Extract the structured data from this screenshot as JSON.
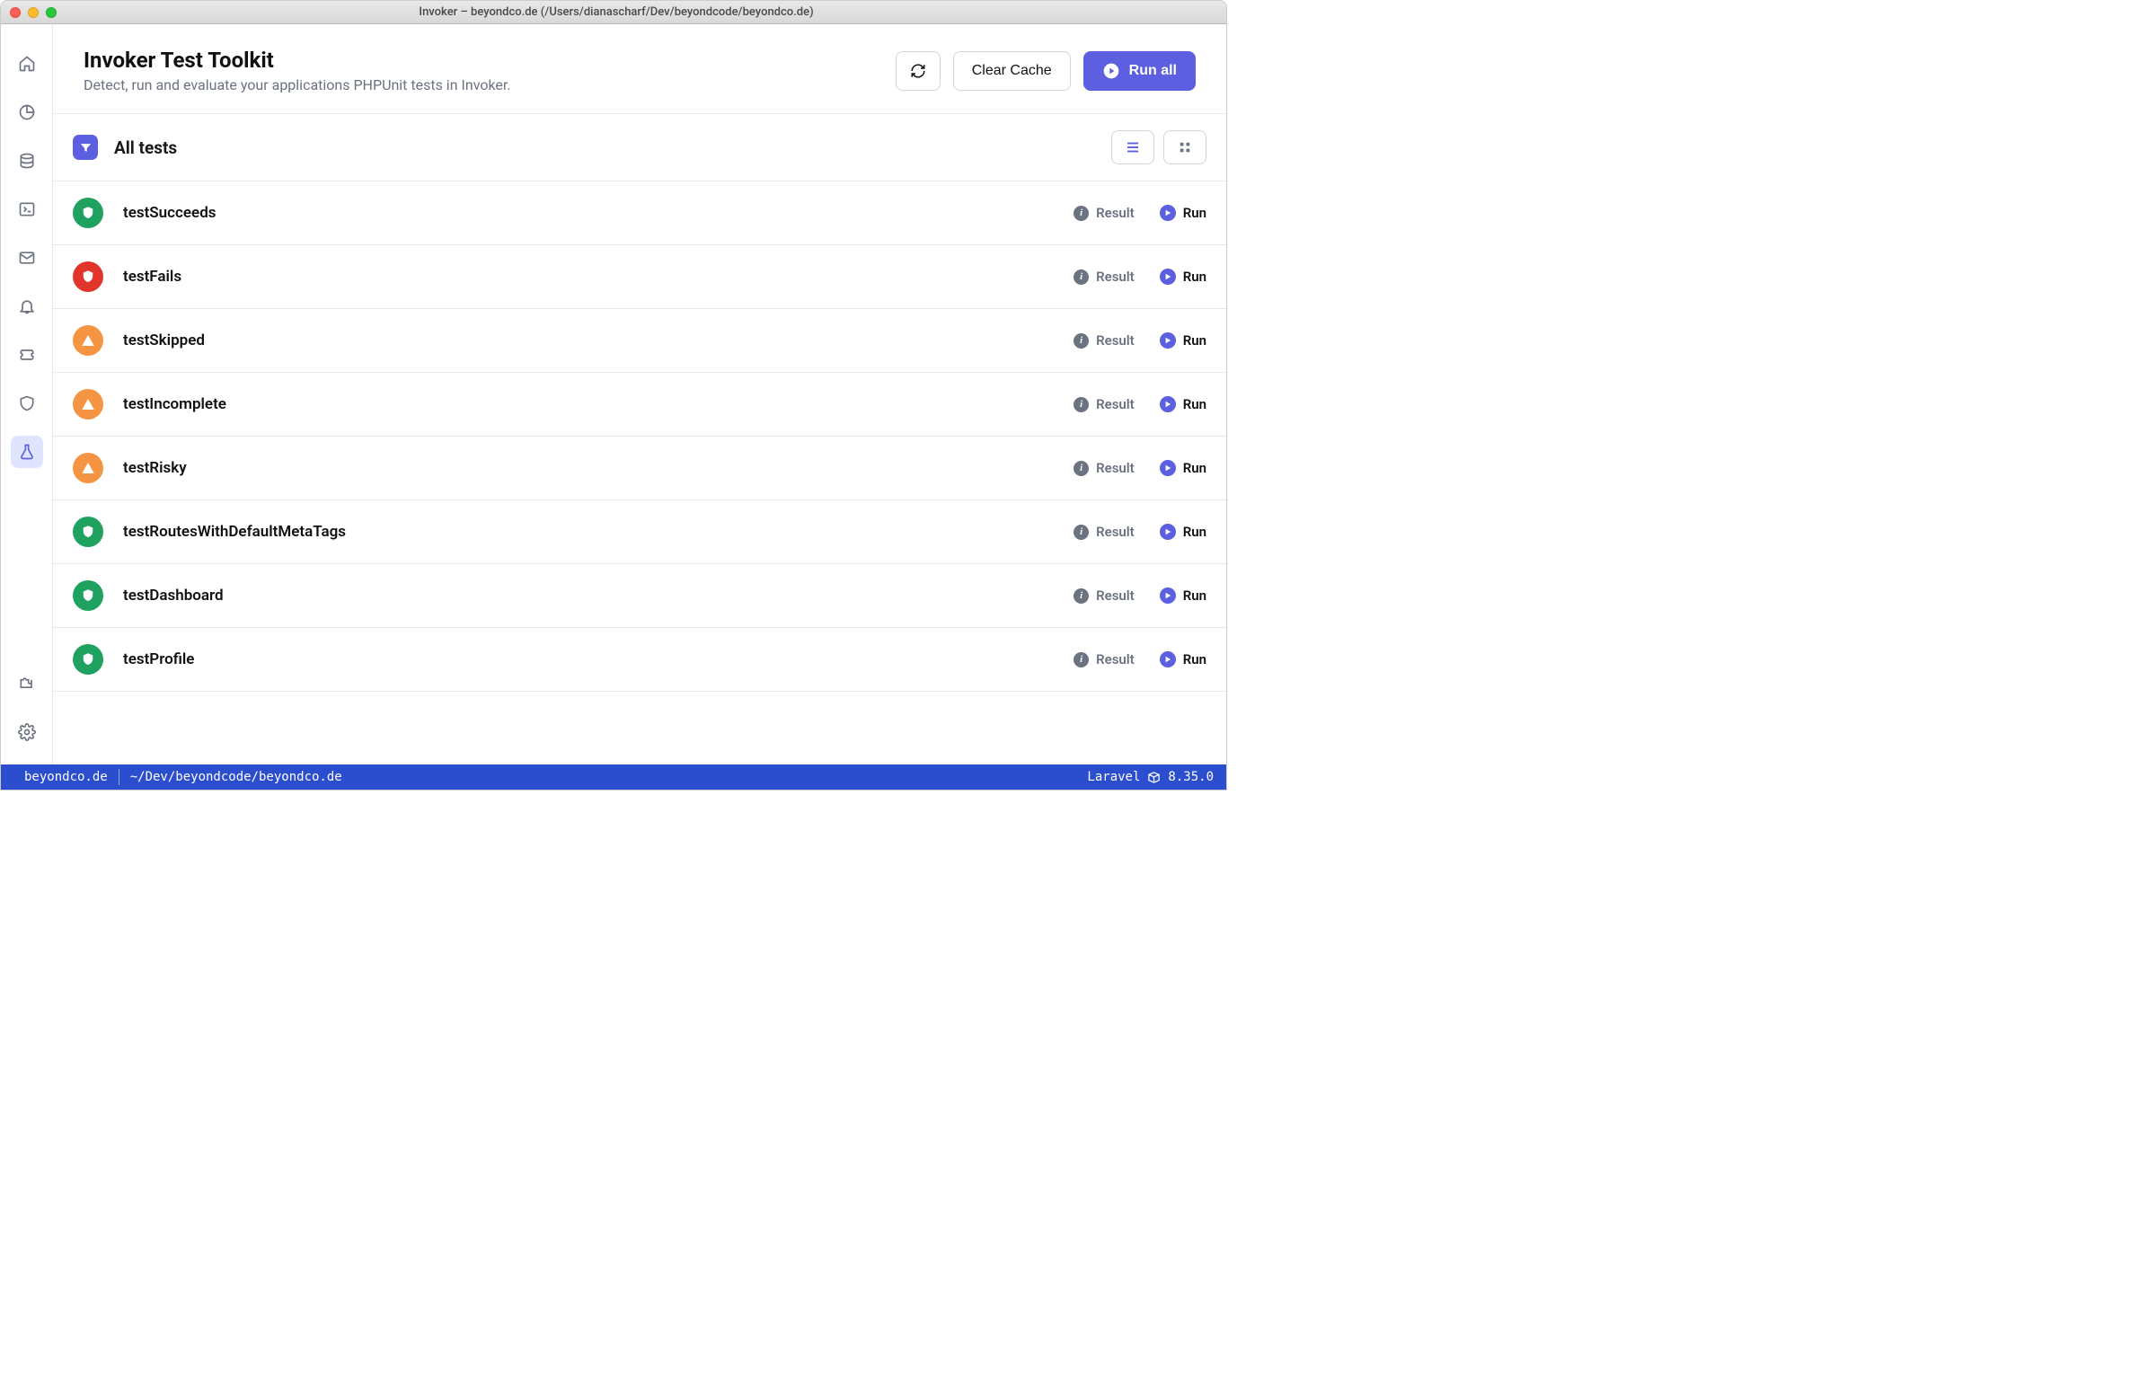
{
  "window": {
    "title": "Invoker – beyondco.de (/Users/dianascharf/Dev/beyondcode/beyondco.de)"
  },
  "header": {
    "title": "Invoker Test Toolkit",
    "subtitle": "Detect, run and evaluate your applications PHPUnit tests in Invoker.",
    "clear_cache_label": "Clear Cache",
    "run_all_label": "Run all"
  },
  "section": {
    "title": "All tests"
  },
  "labels": {
    "result": "Result",
    "run": "Run"
  },
  "tests": [
    {
      "name": "testSucceeds",
      "status": "pass"
    },
    {
      "name": "testFails",
      "status": "fail"
    },
    {
      "name": "testSkipped",
      "status": "warn"
    },
    {
      "name": "testIncomplete",
      "status": "warn"
    },
    {
      "name": "testRisky",
      "status": "warn"
    },
    {
      "name": "testRoutesWithDefaultMetaTags",
      "status": "pass"
    },
    {
      "name": "testDashboard",
      "status": "pass"
    },
    {
      "name": "testProfile",
      "status": "pass"
    }
  ],
  "status_bar": {
    "project": "beyondco.de",
    "path": "~/Dev/beyondcode/beyondco.de",
    "framework": "Laravel",
    "version": "8.35.0"
  }
}
